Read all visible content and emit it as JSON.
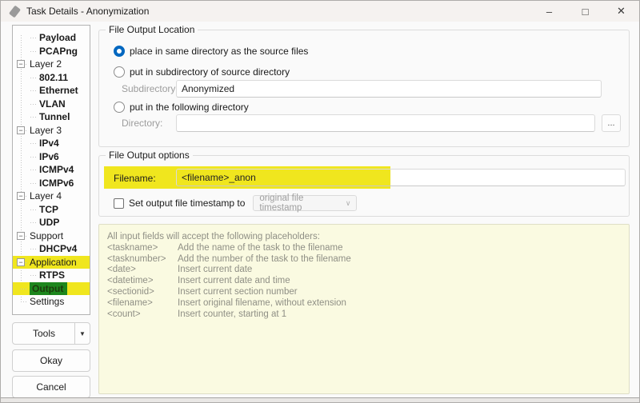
{
  "window": {
    "title": "Task Details - Anonymization"
  },
  "icons": {
    "minimize": "–",
    "maximize": "□",
    "close": "✕",
    "collapse": "−",
    "dropdown_arrow": "▼",
    "combo_chevron": "∨"
  },
  "tree": {
    "items": [
      {
        "label": "Payload",
        "level": 1,
        "bold": true
      },
      {
        "label": "PCAPng",
        "level": 1,
        "bold": true
      },
      {
        "label": "Layer 2",
        "level": 0,
        "box": true
      },
      {
        "label": "802.11",
        "level": 1,
        "bold": true
      },
      {
        "label": "Ethernet",
        "level": 1,
        "bold": true
      },
      {
        "label": "VLAN",
        "level": 1,
        "bold": true
      },
      {
        "label": "Tunnel",
        "level": 1,
        "bold": true
      },
      {
        "label": "Layer 3",
        "level": 0,
        "box": true
      },
      {
        "label": "IPv4",
        "level": 1,
        "bold": true
      },
      {
        "label": "IPv6",
        "level": 1,
        "bold": true
      },
      {
        "label": "ICMPv4",
        "level": 1,
        "bold": true
      },
      {
        "label": "ICMPv6",
        "level": 1,
        "bold": true
      },
      {
        "label": "Layer 4",
        "level": 0,
        "box": true
      },
      {
        "label": "TCP",
        "level": 1,
        "bold": true
      },
      {
        "label": "UDP",
        "level": 1,
        "bold": true
      },
      {
        "label": "Support",
        "level": 0,
        "box": true
      },
      {
        "label": "DHCPv4",
        "level": 1,
        "bold": true
      },
      {
        "label": "Application",
        "level": 0,
        "box": true,
        "highlight": true
      },
      {
        "label": "RTPS",
        "level": 1,
        "bold": true
      },
      {
        "label": "Output",
        "level": 0,
        "selected": true,
        "highlight": true
      },
      {
        "label": "Settings",
        "level": 0
      }
    ]
  },
  "buttons": {
    "tools": "Tools",
    "okay": "Okay",
    "cancel": "Cancel"
  },
  "location_group": {
    "title": "File Output Location",
    "radio_same_dir": "place in same directory as the source files",
    "radio_subdir": "put in subdirectory of source directory",
    "subdir_label": "Subdirectory:",
    "subdir_value": "Anonymized",
    "radio_following": "put in the following directory",
    "dir_label": "Directory:",
    "dir_value": "",
    "browse_label": "..."
  },
  "options_group": {
    "title": "File Output options",
    "filename_label": "Filename:",
    "filename_value": "<filename>_anon",
    "timestamp_checkbox": "Set output file timestamp to",
    "timestamp_value": "original file timestamp"
  },
  "placeholders": {
    "intro": "All input fields will accept the following placeholders:",
    "items": [
      {
        "tag": "<taskname>",
        "desc": "Add the name of the task to the filename"
      },
      {
        "tag": "<tasknumber>",
        "desc": "Add the number of the task to the filename"
      },
      {
        "tag": "<date>",
        "desc": "Insert current date"
      },
      {
        "tag": "<datetime>",
        "desc": "Insert current date and time"
      },
      {
        "tag": "<sectionid>",
        "desc": "Insert current section number"
      },
      {
        "tag": "<filename>",
        "desc": "Insert original filename, without extension"
      },
      {
        "tag": "<count>",
        "desc": "Insert counter, starting at 1"
      }
    ]
  },
  "colors": {
    "highlight_yellow": "#f0e61e",
    "selected_green": "#1d861d",
    "accent_blue": "#0067c0",
    "panel_yellow": "#fafae1"
  }
}
